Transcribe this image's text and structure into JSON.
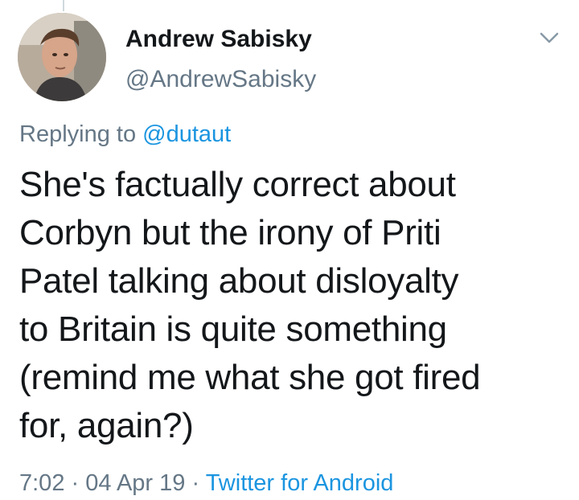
{
  "tweet": {
    "author": {
      "display_name": "Andrew Sabisky",
      "handle": "@AndrewSabisky",
      "avatar_icon": "profile-photo"
    },
    "reply_prefix": "Replying to",
    "reply_to": "@dutaut",
    "text_lines": [
      "She's factually correct about",
      "Corbyn but the irony of Priti",
      "Patel talking about disloyalty",
      "to Britain is quite something",
      "(remind me what she got fired",
      "for, again?)"
    ],
    "time": "7:02",
    "separator": "·",
    "date": "04 Apr 19",
    "source": "Twitter for Android",
    "menu_icon": "chevron-down-icon"
  },
  "colors": {
    "text": "#14171a",
    "secondary": "#657786",
    "link": "#1b95e0",
    "background": "#ffffff"
  }
}
